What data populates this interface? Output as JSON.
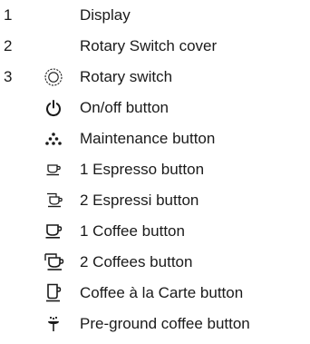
{
  "legend": {
    "items": [
      {
        "number": "1",
        "icon": "",
        "label": "Display"
      },
      {
        "number": "2",
        "icon": "",
        "label": "Rotary Switch cover"
      },
      {
        "number": "3",
        "icon": "rotary-switch-icon",
        "label": "Rotary switch"
      },
      {
        "number": "",
        "icon": "power-icon",
        "label": "On/off button"
      },
      {
        "number": "",
        "icon": "maintenance-icon",
        "label": "Maintenance button"
      },
      {
        "number": "",
        "icon": "espresso-cup-icon",
        "label": "1 Espresso button"
      },
      {
        "number": "",
        "icon": "two-espresso-cups-icon",
        "label": "2 Espressi button"
      },
      {
        "number": "",
        "icon": "coffee-cup-icon",
        "label": "1 Coffee button"
      },
      {
        "number": "",
        "icon": "two-coffee-cups-icon",
        "label": "2 Coffees button"
      },
      {
        "number": "",
        "icon": "large-cup-icon",
        "label": "Coffee à la Carte button"
      },
      {
        "number": "",
        "icon": "measuring-spoon-icon",
        "label": "Pre-ground coffee button"
      }
    ]
  }
}
